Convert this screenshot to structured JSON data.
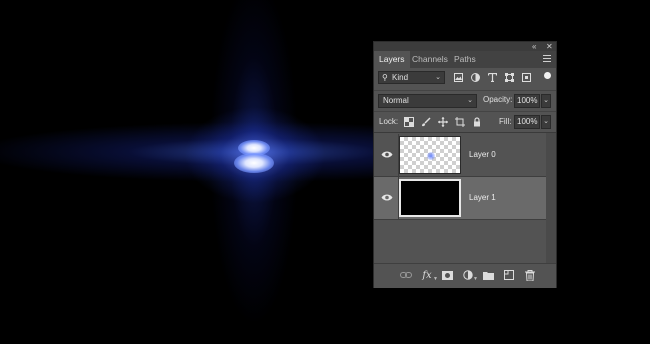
{
  "panel": {
    "tabs": [
      {
        "label": "Layers",
        "active": true
      },
      {
        "label": "Channels",
        "active": false
      },
      {
        "label": "Paths",
        "active": false
      }
    ],
    "collapse_icon": "double-chevron-icon",
    "close_icon": "close-icon",
    "menu_icon": "panel-menu-icon"
  },
  "filter": {
    "kind_label": "Kind",
    "icons": [
      "pixel-layer-filter-icon",
      "adjustment-layer-filter-icon",
      "type-layer-filter-icon",
      "shape-layer-filter-icon",
      "smart-object-filter-icon"
    ],
    "toggle": "filter-toggle-icon"
  },
  "blend": {
    "mode": "Normal",
    "opacity_label": "Opacity:",
    "opacity_value": "100%"
  },
  "lock": {
    "label": "Lock:",
    "icons": [
      "lock-transparent-pixels-icon",
      "lock-image-pixels-icon",
      "lock-position-icon",
      "lock-artboard-icon",
      "lock-all-icon"
    ],
    "fill_label": "Fill:",
    "fill_value": "100%"
  },
  "layers": [
    {
      "name": "Layer 0",
      "visible": true,
      "selected": false,
      "thumbnail": "transparent-with-flare"
    },
    {
      "name": "Layer 1",
      "visible": true,
      "selected": true,
      "thumbnail": "black-fill"
    }
  ],
  "bottom_bar": {
    "icons": [
      "link-layers-icon",
      "layer-style-icon",
      "add-mask-icon",
      "new-adjustment-layer-icon",
      "new-group-icon",
      "new-layer-icon",
      "delete-layer-icon"
    ],
    "fx_label": "fx"
  },
  "colors": {
    "panel_bg": "#535353",
    "selected_row": "#6a6a6a",
    "canvas_bg": "#000000",
    "flare_blue": "#4664ff"
  }
}
